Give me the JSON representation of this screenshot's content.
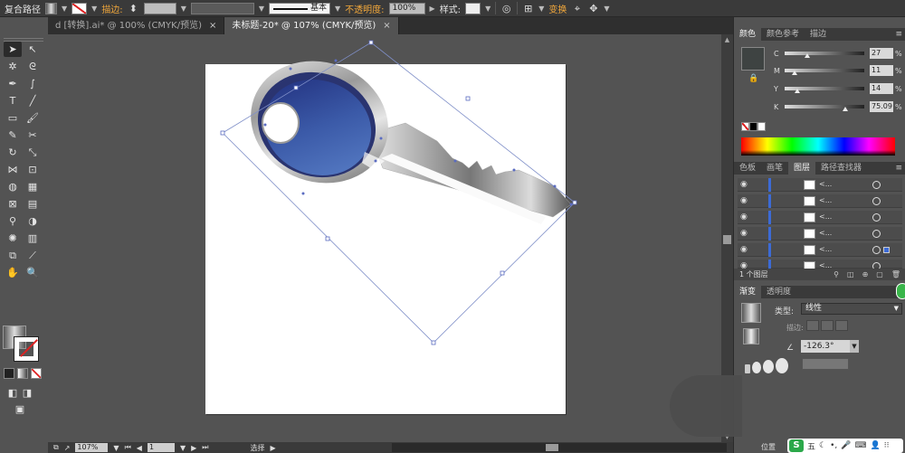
{
  "control_bar": {
    "object_type": "复合路径",
    "stroke_label": "描边:",
    "stroke_style": "基本",
    "opacity_label": "不透明度:",
    "opacity_value": "100%",
    "style_label": "样式:",
    "transform_label": "变换"
  },
  "tabs": [
    {
      "label": "d [转换].ai* @ 100% (CMYK/预览)",
      "active": false
    },
    {
      "label": "未标题-20* @ 107% (CMYK/预览)",
      "active": true
    }
  ],
  "color_panel": {
    "tabs": [
      "颜色",
      "颜色参考",
      "描边"
    ],
    "channels": [
      {
        "name": "C",
        "value": "27",
        "pct": "%",
        "pos": 0.27
      },
      {
        "name": "M",
        "value": "11",
        "pct": "%",
        "pos": 0.11
      },
      {
        "name": "Y",
        "value": "14",
        "pct": "%",
        "pos": 0.14
      },
      {
        "name": "K",
        "value": "75.09",
        "pct": "%",
        "pos": 0.75
      }
    ],
    "swatch_color": "#3e4342"
  },
  "layers_panel": {
    "tabs": [
      "色板",
      "画笔",
      "图层",
      "路径查找器"
    ],
    "active_tab": "图层",
    "rows": [
      {
        "name": "<...",
        "current": false
      },
      {
        "name": "<...",
        "current": false
      },
      {
        "name": "<...",
        "current": false
      },
      {
        "name": "<...",
        "current": false
      },
      {
        "name": "<...",
        "current": true
      },
      {
        "name": "<...",
        "current": false
      }
    ],
    "footer": "1 个图层"
  },
  "gradient_panel": {
    "tabs": [
      "渐变",
      "透明度"
    ],
    "type_label": "类型:",
    "type_value": "线性",
    "stroke_label": "描边:",
    "angle_value": "-126.3°",
    "location_label": "位置"
  },
  "status_bar": {
    "zoom": "107%",
    "page": "1",
    "tool": "选择"
  },
  "ime": {
    "logo": "S",
    "mode": "五"
  },
  "colors": {
    "accent": "#3c6bd6",
    "link_orange": "#f1a73b",
    "key_blue": "#3a5aa8"
  }
}
